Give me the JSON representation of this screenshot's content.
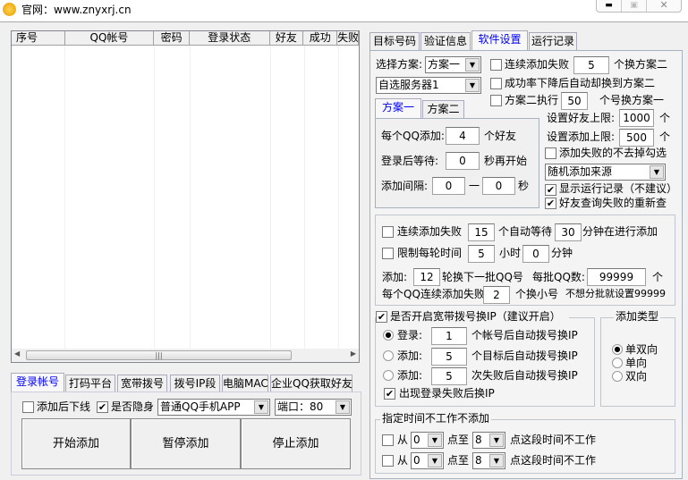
{
  "title": {
    "text": "官网：www.znyxrj.cn",
    "icon": "app-logo-icon"
  },
  "window_controls": {
    "minimize": "minimize-icon",
    "maximize": "maximize-icon",
    "close": "close-icon"
  },
  "table": {
    "columns": [
      "序号",
      "QQ帐号",
      "密码",
      "登录状态",
      "好友",
      "成功",
      "失败"
    ],
    "rows": []
  },
  "bottom_tabs": [
    {
      "label": "登录帐号",
      "selected": true
    },
    {
      "label": "打码平台"
    },
    {
      "label": "宽带拨号"
    },
    {
      "label": "拨号IP段"
    },
    {
      "label": "电脑MAC"
    },
    {
      "label": "企业QQ获取好友"
    }
  ],
  "login_options": {
    "offline_after_add": {
      "label": "添加后下线",
      "checked": false
    },
    "invisible": {
      "label": "是否隐身",
      "checked": true
    },
    "client_type": "普通QQ手机APP",
    "port": "端口：80"
  },
  "buttons": {
    "start": "开始添加",
    "pause": "暂停添加",
    "stop": "停止添加"
  },
  "right_tabs": [
    {
      "label": "目标号码"
    },
    {
      "label": "验证信息"
    },
    {
      "label": "软件设置",
      "selected": true
    },
    {
      "label": "运行记录"
    }
  ],
  "settings": {
    "scheme_label": "选择方案:",
    "scheme_value": "方案一",
    "server_value": "自选服务器1",
    "cont_fail": {
      "label": "连续添加失败",
      "value": "5",
      "suffix": "个换方案二",
      "checked": false
    },
    "rate_drop": {
      "label": "成功率下降后自动却换到方案二",
      "checked": false
    },
    "scheme2_exec": {
      "label": "方案二执行",
      "value": "50",
      "suffix": "个号换方案一",
      "checked": false
    },
    "scheme_tabs": [
      {
        "label": "方案一",
        "selected": true
      },
      {
        "label": "方案二"
      }
    ],
    "per_qq_add": {
      "label": "每个QQ添加:",
      "value": "4",
      "suffix": "个好友"
    },
    "login_wait": {
      "label": "登录后等待:",
      "value": "0",
      "suffix": "秒再开始"
    },
    "interval": {
      "label": "添加间隔:",
      "from": "0",
      "sep": "一",
      "to": "0",
      "suffix": "秒"
    },
    "friend_limit": {
      "label": "设置好友上限:",
      "value": "1000",
      "suffix": "个"
    },
    "add_limit": {
      "label": "设置添加上限:",
      "value": "500",
      "suffix": "个"
    },
    "keep_unchecked": {
      "label": "添加失败的不去掉勾选",
      "checked": false
    },
    "source": "随机添加来源",
    "show_log": {
      "label": "显示运行记录（不建议）",
      "checked": true
    },
    "requery": {
      "label": "好友查询失败的重新查",
      "checked": true
    }
  },
  "wait": {
    "cont_fail": {
      "label": "连续添加失败",
      "value": "15",
      "mid": "个自动等待",
      "value2": "30",
      "suffix": "分钟在进行添加",
      "checked": false
    },
    "limit_round": {
      "label": "限制每轮时间",
      "hours": "5",
      "hours_label": "小时",
      "minutes": "0",
      "minutes_label": "分钟",
      "checked": false
    },
    "batch": {
      "label": "添加:",
      "value": "12",
      "suffix": "轮换下一批QQ号",
      "batch_label": "每批QQ数:",
      "batch_value": "99999",
      "batch_suffix": "个"
    },
    "per_qq_fail": {
      "label": "每个QQ连续添加失败",
      "value": "2",
      "suffix": "个换小号",
      "note": "不想分批就设置99999"
    }
  },
  "dial": {
    "enable": {
      "label": "是否开启宽带拨号换IP（建议开启）",
      "checked": true
    },
    "opts": [
      {
        "label": "登录:",
        "value": "1",
        "suffix": "个帐号后自动拨号换IP",
        "selected": true
      },
      {
        "label": "添加:",
        "value": "5",
        "suffix": "个目标后自动拨号换IP",
        "selected": false
      },
      {
        "label": "添加:",
        "value": "5",
        "suffix": "次失败后自动拨号换IP",
        "selected": false
      }
    ],
    "login_fail": {
      "label": "出现登录失败后换IP",
      "checked": true
    }
  },
  "add_type": {
    "title": "添加类型",
    "options": [
      {
        "label": "单双向",
        "selected": true
      },
      {
        "label": "单向",
        "selected": false
      },
      {
        "label": "双向",
        "selected": false
      }
    ]
  },
  "schedule": {
    "title": "指定时间不工作不添加",
    "rows": [
      {
        "from_label": "从",
        "from": "0",
        "to_label": "点至",
        "to": "8",
        "suffix": "点这段时间不工作",
        "checked": false
      },
      {
        "from_label": "从",
        "from": "0",
        "to_label": "点至",
        "to": "8",
        "suffix": "点这段时间不工作",
        "checked": false
      }
    ]
  }
}
